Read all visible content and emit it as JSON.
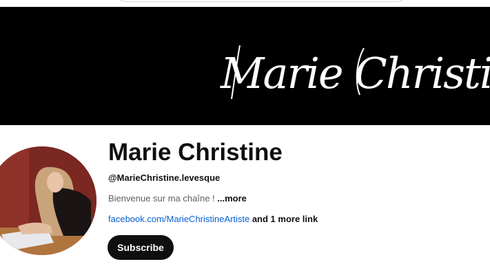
{
  "banner": {
    "script_text": "Marie Christine"
  },
  "channel": {
    "name": "Marie Christine",
    "handle": "@MarieChristine.levesque",
    "description": "Bienvenue sur ma chaîne ! ",
    "more_label": "...more",
    "link_text": "facebook.com/MarieChristineArtiste",
    "more_links_label": " and 1 more link"
  },
  "actions": {
    "subscribe_label": "Subscribe"
  }
}
